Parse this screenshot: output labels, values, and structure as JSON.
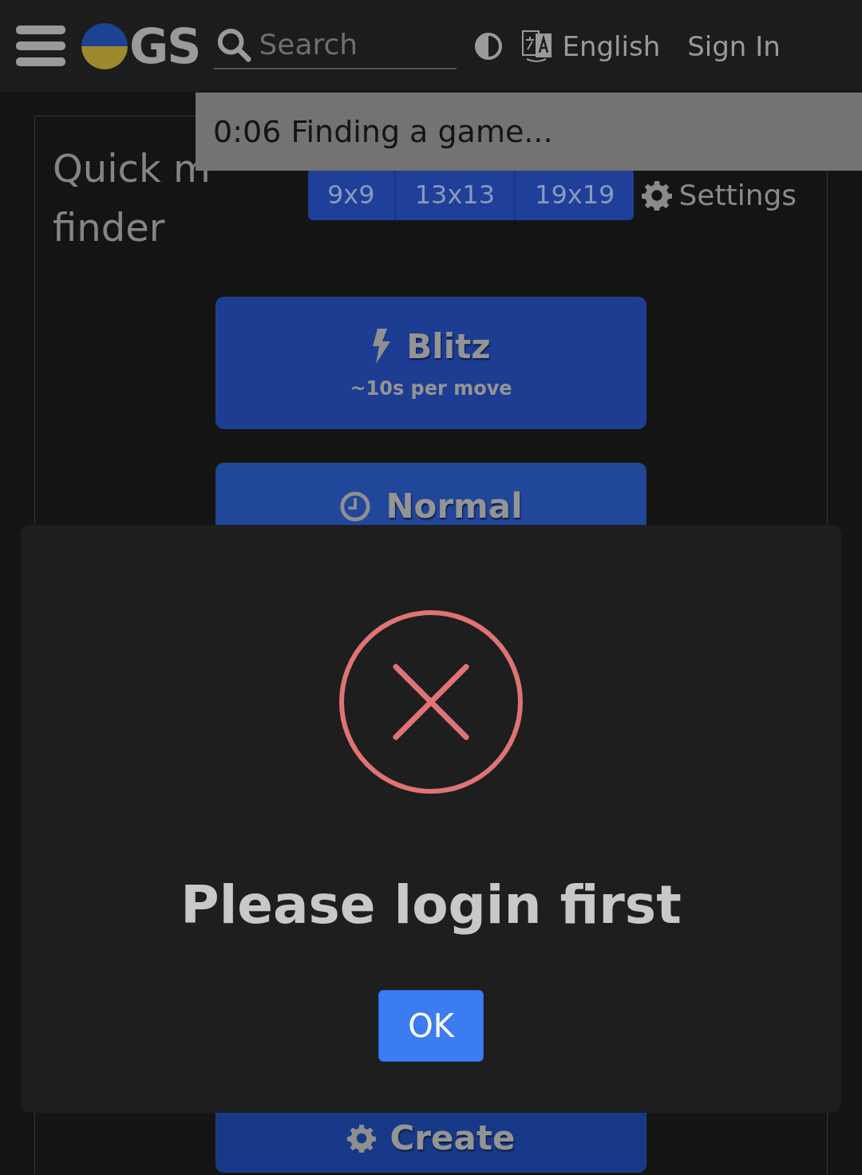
{
  "header": {
    "logo_text": "GS",
    "search": {
      "placeholder": "Search"
    },
    "language": "English",
    "sign_in": "Sign In"
  },
  "toast": {
    "text": "0:06 Finding a game..."
  },
  "quick_match": {
    "title_lines": [
      "Quick m",
      "finder"
    ],
    "board_sizes": [
      {
        "label": "9x9",
        "selected": false
      },
      {
        "label": "13x13",
        "selected": false
      },
      {
        "label": "19x19",
        "selected": false
      }
    ],
    "settings": "Settings",
    "speed_buttons": [
      {
        "kind": "blitz",
        "label": "Blitz",
        "subtitle": "~10s per move"
      },
      {
        "kind": "normal",
        "label": "Normal"
      },
      {
        "kind": "create",
        "label": "Create"
      }
    ]
  },
  "dialog": {
    "kind": "error",
    "message": "Please login first",
    "button": "OK"
  }
}
